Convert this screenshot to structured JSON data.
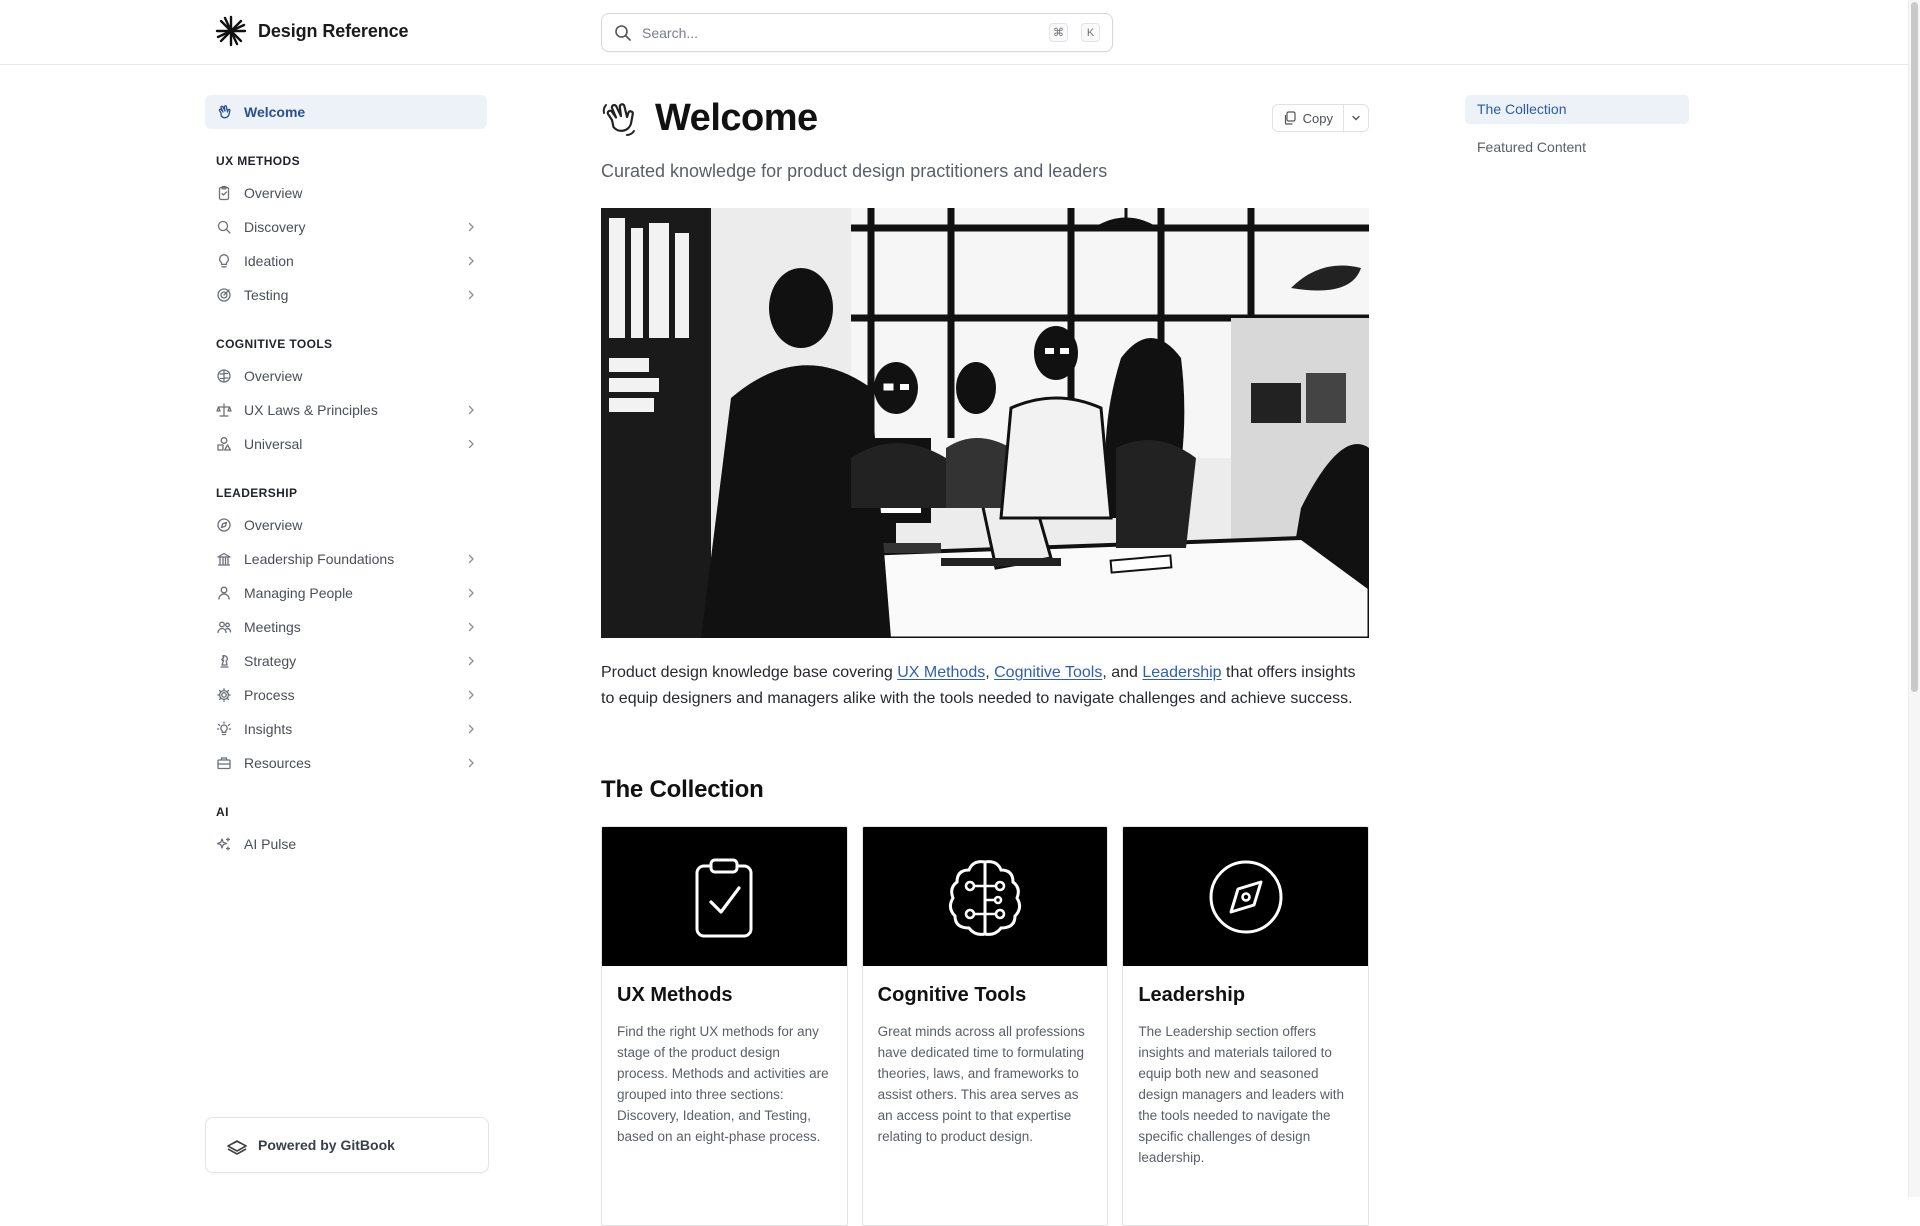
{
  "header": {
    "logo_text": "Design Reference",
    "search_placeholder": "Search...",
    "shortcut_keys": [
      "⌘",
      "K"
    ]
  },
  "sidebar": {
    "top_item": {
      "label": "Welcome",
      "icon": "wave-hand-icon",
      "active": true
    },
    "sections": [
      {
        "title": "UX METHODS",
        "items": [
          {
            "label": "Overview",
            "icon": "clipboard-icon",
            "expandable": false
          },
          {
            "label": "Discovery",
            "icon": "search-icon",
            "expandable": true
          },
          {
            "label": "Ideation",
            "icon": "lightbulb-icon",
            "expandable": true
          },
          {
            "label": "Testing",
            "icon": "target-icon",
            "expandable": true
          }
        ]
      },
      {
        "title": "COGNITIVE TOOLS",
        "items": [
          {
            "label": "Overview",
            "icon": "brain-icon",
            "expandable": false
          },
          {
            "label": "UX Laws & Principles",
            "icon": "scale-icon",
            "expandable": true
          },
          {
            "label": "Universal",
            "icon": "shapes-icon",
            "expandable": true
          }
        ]
      },
      {
        "title": "LEADERSHIP",
        "items": [
          {
            "label": "Overview",
            "icon": "compass-icon",
            "expandable": false
          },
          {
            "label": "Leadership Foundations",
            "icon": "building-icon",
            "expandable": true
          },
          {
            "label": "Managing People",
            "icon": "person-icon",
            "expandable": true
          },
          {
            "label": "Meetings",
            "icon": "people-icon",
            "expandable": true
          },
          {
            "label": "Strategy",
            "icon": "chess-icon",
            "expandable": true
          },
          {
            "label": "Process",
            "icon": "gear-icon",
            "expandable": true
          },
          {
            "label": "Insights",
            "icon": "bulb-rays-icon",
            "expandable": true
          },
          {
            "label": "Resources",
            "icon": "toolbox-icon",
            "expandable": true
          }
        ]
      },
      {
        "title": "AI",
        "items": [
          {
            "label": "AI Pulse",
            "icon": "sparkles-icon",
            "expandable": false
          }
        ]
      }
    ],
    "footer": "Powered by GitBook"
  },
  "main": {
    "title": "Welcome",
    "copy_label": "Copy",
    "subtitle": "Curated knowledge for product design practitioners and leaders",
    "intro": {
      "before": "Product design knowledge base covering ",
      "link1": "UX Methods",
      "sep1": ", ",
      "link2": "Cognitive Tools",
      "sep2": ", and ",
      "link3": "Leadership",
      "after": " that offers insights to equip designers and managers alike with the tools needed to navigate challenges and achieve success."
    },
    "collection_heading": "The Collection",
    "cards": [
      {
        "title": "UX Methods",
        "icon": "clipboard-check-icon",
        "desc": "Find the right UX methods for any stage of the product design process. Methods and activities are grouped into three sections: Discovery, Ideation, and Testing, based on an eight-phase process."
      },
      {
        "title": "Cognitive Tools",
        "icon": "brain-circuit-icon",
        "desc": "Great minds across all professions have dedicated time to formulating theories, laws, and frameworks to assist others. This area serves as an access point to that expertise relating to product design."
      },
      {
        "title": "Leadership",
        "icon": "compass-icon",
        "desc": "The Leadership section offers insights and materials tailored to equip both new and seasoned design managers and leaders with the tools needed to navigate the specific challenges of design leadership."
      }
    ]
  },
  "toc": {
    "items": [
      {
        "label": "The Collection",
        "active": true
      },
      {
        "label": "Featured Content",
        "active": false
      }
    ]
  },
  "colors": {
    "accent": "#2b5aa6",
    "active_bg": "#edf1f8",
    "text": "#1f2328",
    "muted": "#5a5f67"
  }
}
